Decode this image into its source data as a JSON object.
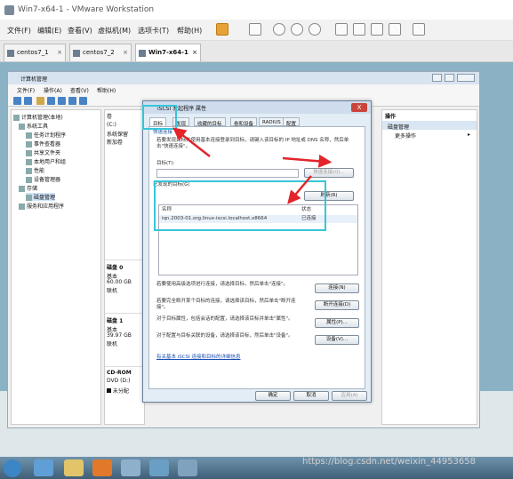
{
  "vm": {
    "title": "Win7-x64-1 - VMware Workstation",
    "menu": [
      "文件(F)",
      "编辑(E)",
      "查看(V)",
      "虚拟机(M)",
      "选项卡(T)",
      "帮助(H)"
    ],
    "tabs": [
      "centos7_1",
      "centos7_2",
      "Win7-x64-1"
    ],
    "tab_close": "×"
  },
  "cm": {
    "title": "计算机管理",
    "menu": [
      "文件(F)",
      "操作(A)",
      "查看(V)",
      "帮助(H)"
    ],
    "tree": [
      "计算机管理(本地)",
      "系统工具",
      "任务计划程序",
      "事件查看器",
      "共享文件夹",
      "本地用户和组",
      "性能",
      "设备管理器",
      "存储",
      "磁盘管理",
      "服务和应用程序"
    ],
    "mid": {
      "header": "卷",
      "items": [
        "(C:)",
        "系统保留",
        "新加卷"
      ]
    },
    "right": {
      "header": "操作",
      "item1": "磁盘管理",
      "item2": "更多操作"
    },
    "disks": [
      {
        "name": "磁盘 0",
        "type": "基本",
        "size": "60.00 GB",
        "status": "联机"
      },
      {
        "name": "磁盘 1",
        "type": "基本",
        "size": "39.97 GB",
        "status": "联机"
      }
    ],
    "cdrom": {
      "name": "CD-ROM",
      "drive": "DVD (D:)"
    },
    "legend": "未分配"
  },
  "dlg": {
    "title": "iSCSI 发起程序 属性",
    "close": "X",
    "tabs": [
      "目标",
      "发现",
      "收藏的目标",
      "卷和设备",
      "RADIUS",
      "配置"
    ],
    "quick_label": "快速连接",
    "quick_desc": "若要发现目标并使用基本连接登录到目标，请键入该目标的 IP 地址或 DNS 名称，然后单击\"快速连接\"。",
    "target_label": "目标(T):",
    "quick_btn": "快速连接(Q)...",
    "discovered_label": "已发现的目标(G)",
    "refresh_btn": "刷新(R)",
    "col_name": "名称",
    "col_status": "状态",
    "row_name": "iqn.2003-01.org.linux-iscsi.localhost.x8664",
    "row_status": "已连接",
    "actions": [
      {
        "text": "若要使用高级选项进行连接，请选择目标，然后单击\"连接\"。",
        "btn": "连接(N)"
      },
      {
        "text": "若要完全断开某个目标的连接，请选择该目标，然后单击\"断开连接\"。",
        "btn": "断开连接(D)"
      },
      {
        "text": "对于目标属性，包括会话的配置，请选择该目标并单击\"属性\"。",
        "btn": "属性(P)..."
      },
      {
        "text": "对于配置与目标关联的设备，请选择该目标，然后单击\"设备\"。",
        "btn": "设备(V)..."
      }
    ],
    "link": "有关基本 iSCSI 连接和目标的详细信息",
    "ok": "确定",
    "cancel": "取消",
    "apply": "应用(A)"
  },
  "watermark": "https://blog.csdn.net/weixin_44953658"
}
